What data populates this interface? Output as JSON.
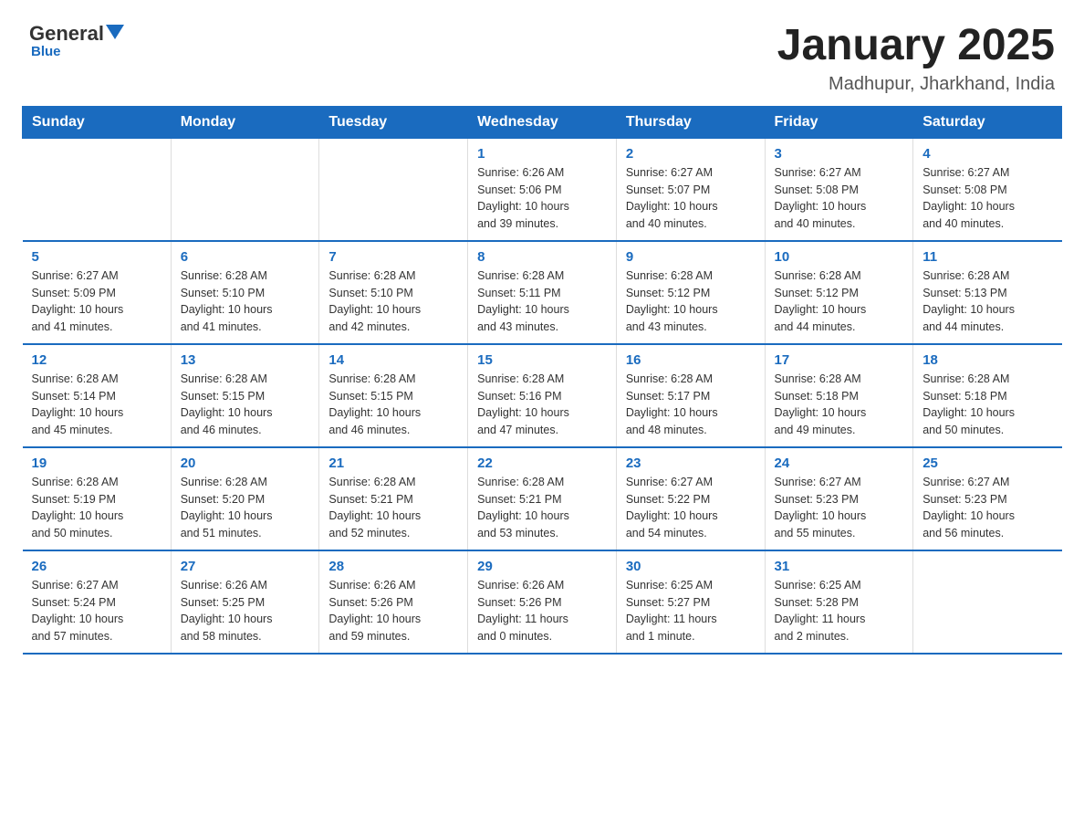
{
  "logo": {
    "general": "General",
    "blue": "Blue",
    "underline": "Blue"
  },
  "title": {
    "main": "January 2025",
    "sub": "Madhupur, Jharkhand, India"
  },
  "weekdays": [
    "Sunday",
    "Monday",
    "Tuesday",
    "Wednesday",
    "Thursday",
    "Friday",
    "Saturday"
  ],
  "weeks": [
    [
      {
        "day": "",
        "info": ""
      },
      {
        "day": "",
        "info": ""
      },
      {
        "day": "",
        "info": ""
      },
      {
        "day": "1",
        "info": "Sunrise: 6:26 AM\nSunset: 5:06 PM\nDaylight: 10 hours\nand 39 minutes."
      },
      {
        "day": "2",
        "info": "Sunrise: 6:27 AM\nSunset: 5:07 PM\nDaylight: 10 hours\nand 40 minutes."
      },
      {
        "day": "3",
        "info": "Sunrise: 6:27 AM\nSunset: 5:08 PM\nDaylight: 10 hours\nand 40 minutes."
      },
      {
        "day": "4",
        "info": "Sunrise: 6:27 AM\nSunset: 5:08 PM\nDaylight: 10 hours\nand 40 minutes."
      }
    ],
    [
      {
        "day": "5",
        "info": "Sunrise: 6:27 AM\nSunset: 5:09 PM\nDaylight: 10 hours\nand 41 minutes."
      },
      {
        "day": "6",
        "info": "Sunrise: 6:28 AM\nSunset: 5:10 PM\nDaylight: 10 hours\nand 41 minutes."
      },
      {
        "day": "7",
        "info": "Sunrise: 6:28 AM\nSunset: 5:10 PM\nDaylight: 10 hours\nand 42 minutes."
      },
      {
        "day": "8",
        "info": "Sunrise: 6:28 AM\nSunset: 5:11 PM\nDaylight: 10 hours\nand 43 minutes."
      },
      {
        "day": "9",
        "info": "Sunrise: 6:28 AM\nSunset: 5:12 PM\nDaylight: 10 hours\nand 43 minutes."
      },
      {
        "day": "10",
        "info": "Sunrise: 6:28 AM\nSunset: 5:12 PM\nDaylight: 10 hours\nand 44 minutes."
      },
      {
        "day": "11",
        "info": "Sunrise: 6:28 AM\nSunset: 5:13 PM\nDaylight: 10 hours\nand 44 minutes."
      }
    ],
    [
      {
        "day": "12",
        "info": "Sunrise: 6:28 AM\nSunset: 5:14 PM\nDaylight: 10 hours\nand 45 minutes."
      },
      {
        "day": "13",
        "info": "Sunrise: 6:28 AM\nSunset: 5:15 PM\nDaylight: 10 hours\nand 46 minutes."
      },
      {
        "day": "14",
        "info": "Sunrise: 6:28 AM\nSunset: 5:15 PM\nDaylight: 10 hours\nand 46 minutes."
      },
      {
        "day": "15",
        "info": "Sunrise: 6:28 AM\nSunset: 5:16 PM\nDaylight: 10 hours\nand 47 minutes."
      },
      {
        "day": "16",
        "info": "Sunrise: 6:28 AM\nSunset: 5:17 PM\nDaylight: 10 hours\nand 48 minutes."
      },
      {
        "day": "17",
        "info": "Sunrise: 6:28 AM\nSunset: 5:18 PM\nDaylight: 10 hours\nand 49 minutes."
      },
      {
        "day": "18",
        "info": "Sunrise: 6:28 AM\nSunset: 5:18 PM\nDaylight: 10 hours\nand 50 minutes."
      }
    ],
    [
      {
        "day": "19",
        "info": "Sunrise: 6:28 AM\nSunset: 5:19 PM\nDaylight: 10 hours\nand 50 minutes."
      },
      {
        "day": "20",
        "info": "Sunrise: 6:28 AM\nSunset: 5:20 PM\nDaylight: 10 hours\nand 51 minutes."
      },
      {
        "day": "21",
        "info": "Sunrise: 6:28 AM\nSunset: 5:21 PM\nDaylight: 10 hours\nand 52 minutes."
      },
      {
        "day": "22",
        "info": "Sunrise: 6:28 AM\nSunset: 5:21 PM\nDaylight: 10 hours\nand 53 minutes."
      },
      {
        "day": "23",
        "info": "Sunrise: 6:27 AM\nSunset: 5:22 PM\nDaylight: 10 hours\nand 54 minutes."
      },
      {
        "day": "24",
        "info": "Sunrise: 6:27 AM\nSunset: 5:23 PM\nDaylight: 10 hours\nand 55 minutes."
      },
      {
        "day": "25",
        "info": "Sunrise: 6:27 AM\nSunset: 5:23 PM\nDaylight: 10 hours\nand 56 minutes."
      }
    ],
    [
      {
        "day": "26",
        "info": "Sunrise: 6:27 AM\nSunset: 5:24 PM\nDaylight: 10 hours\nand 57 minutes."
      },
      {
        "day": "27",
        "info": "Sunrise: 6:26 AM\nSunset: 5:25 PM\nDaylight: 10 hours\nand 58 minutes."
      },
      {
        "day": "28",
        "info": "Sunrise: 6:26 AM\nSunset: 5:26 PM\nDaylight: 10 hours\nand 59 minutes."
      },
      {
        "day": "29",
        "info": "Sunrise: 6:26 AM\nSunset: 5:26 PM\nDaylight: 11 hours\nand 0 minutes."
      },
      {
        "day": "30",
        "info": "Sunrise: 6:25 AM\nSunset: 5:27 PM\nDaylight: 11 hours\nand 1 minute."
      },
      {
        "day": "31",
        "info": "Sunrise: 6:25 AM\nSunset: 5:28 PM\nDaylight: 11 hours\nand 2 minutes."
      },
      {
        "day": "",
        "info": ""
      }
    ]
  ]
}
